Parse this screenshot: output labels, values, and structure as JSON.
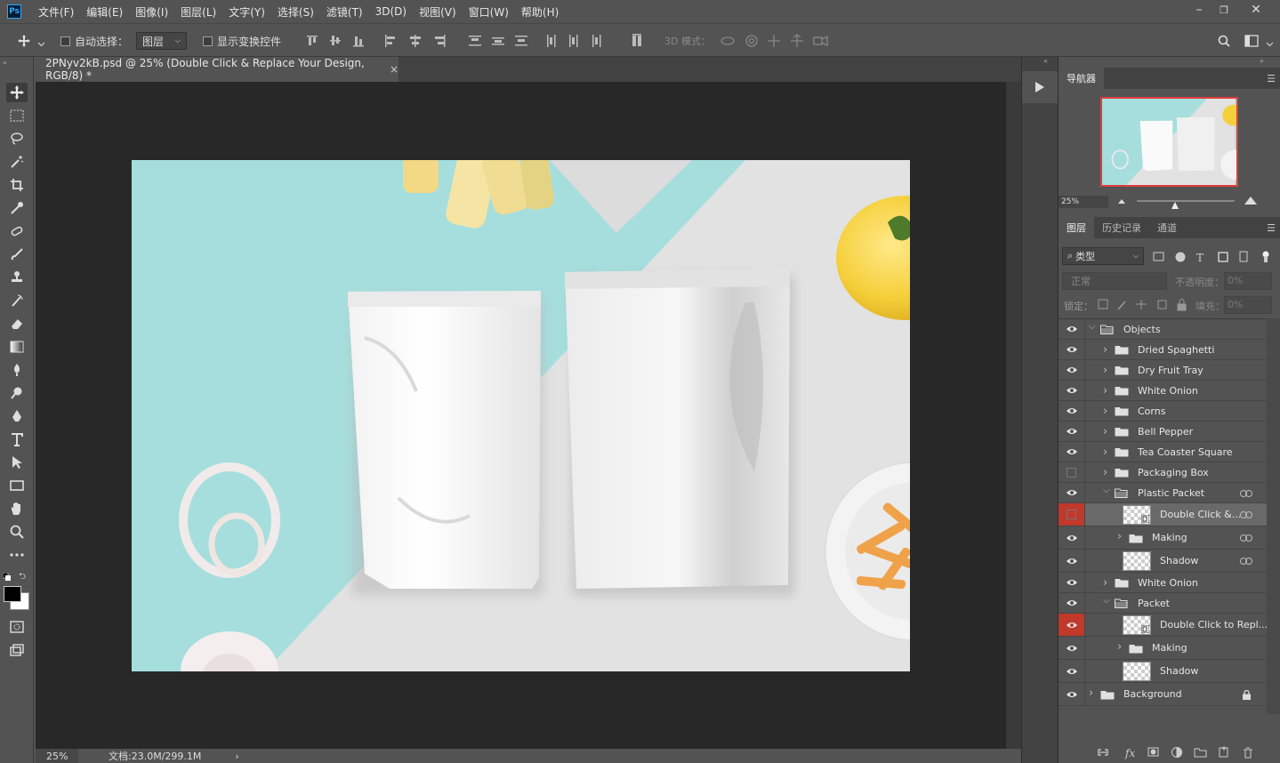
{
  "menubar": {
    "logo": "Ps",
    "items": [
      "文件(F)",
      "编辑(E)",
      "图像(I)",
      "图层(L)",
      "文字(Y)",
      "选择(S)",
      "滤镜(T)",
      "3D(D)",
      "视图(V)",
      "窗口(W)",
      "帮助(H)"
    ],
    "window_controls": [
      "–",
      "❐",
      "✕"
    ]
  },
  "options": {
    "auto_select_label": "自动选择：",
    "auto_select_target": "图层",
    "show_transform_label": "显示变换控件",
    "mode_3d_label": "3D 模式："
  },
  "document": {
    "tab_title": "2PNyv2kB.psd @ 25% (Double Click & Replace Your Design, RGB/8) *",
    "tab_close": "×",
    "zoom": "25%",
    "doc_info": "文档:23.0M/299.1M",
    "status_arrow": "›"
  },
  "navigator": {
    "tab": "导航器",
    "zoom": "25%"
  },
  "layers_panel": {
    "tabs": [
      "图层",
      "历史记录",
      "通道"
    ],
    "filter_label": "类型",
    "blend_mode": "正常",
    "opacity_label": "不透明度：",
    "opacity_value": "0%",
    "lock_label": "锁定：",
    "fill_label": "填充：",
    "fill_value": "0%",
    "layers": [
      {
        "name": "Objects",
        "type": "group",
        "expanded": true,
        "visible": true
      },
      {
        "name": "Dried Spaghetti",
        "type": "group",
        "expanded": false,
        "visible": true
      },
      {
        "name": "Dry Fruit Tray",
        "type": "group",
        "expanded": false,
        "visible": true
      },
      {
        "name": "White Onion",
        "type": "group",
        "expanded": false,
        "visible": true
      },
      {
        "name": "Corns",
        "type": "group",
        "expanded": false,
        "visible": true
      },
      {
        "name": "Bell Pepper",
        "type": "group",
        "expanded": false,
        "visible": true
      },
      {
        "name": "Tea Coaster Square",
        "type": "group",
        "expanded": false,
        "visible": true
      },
      {
        "name": "Packaging Box",
        "type": "group",
        "expanded": false,
        "visible": false
      },
      {
        "name": "Plastic Packet",
        "type": "group",
        "expanded": true,
        "visible": true,
        "linked": true
      },
      {
        "name": "Double Click &...",
        "type": "smart",
        "visible": false,
        "selected": true,
        "linked": true
      },
      {
        "name": "Making",
        "type": "group",
        "expanded": false,
        "visible": true,
        "linked": true
      },
      {
        "name": "Shadow",
        "type": "pixel",
        "visible": true,
        "linked": true
      },
      {
        "name": "White Onion",
        "type": "group",
        "expanded": false,
        "visible": true
      },
      {
        "name": "Packet",
        "type": "group",
        "expanded": true,
        "visible": true
      },
      {
        "name": "Double Click to Repl...",
        "type": "smart",
        "visible": true,
        "highlight": true
      },
      {
        "name": "Making",
        "type": "group",
        "expanded": false,
        "visible": true
      },
      {
        "name": "Shadow",
        "type": "pixel",
        "visible": true
      },
      {
        "name": "Background",
        "type": "group",
        "expanded": false,
        "visible": true,
        "locked": true
      }
    ]
  },
  "colors": {
    "ui_bg": "#535353",
    "canvas_bg": "#282828",
    "accent_red": "#c0392b",
    "selected_row": "#696969",
    "teal": "#a6dedd"
  }
}
